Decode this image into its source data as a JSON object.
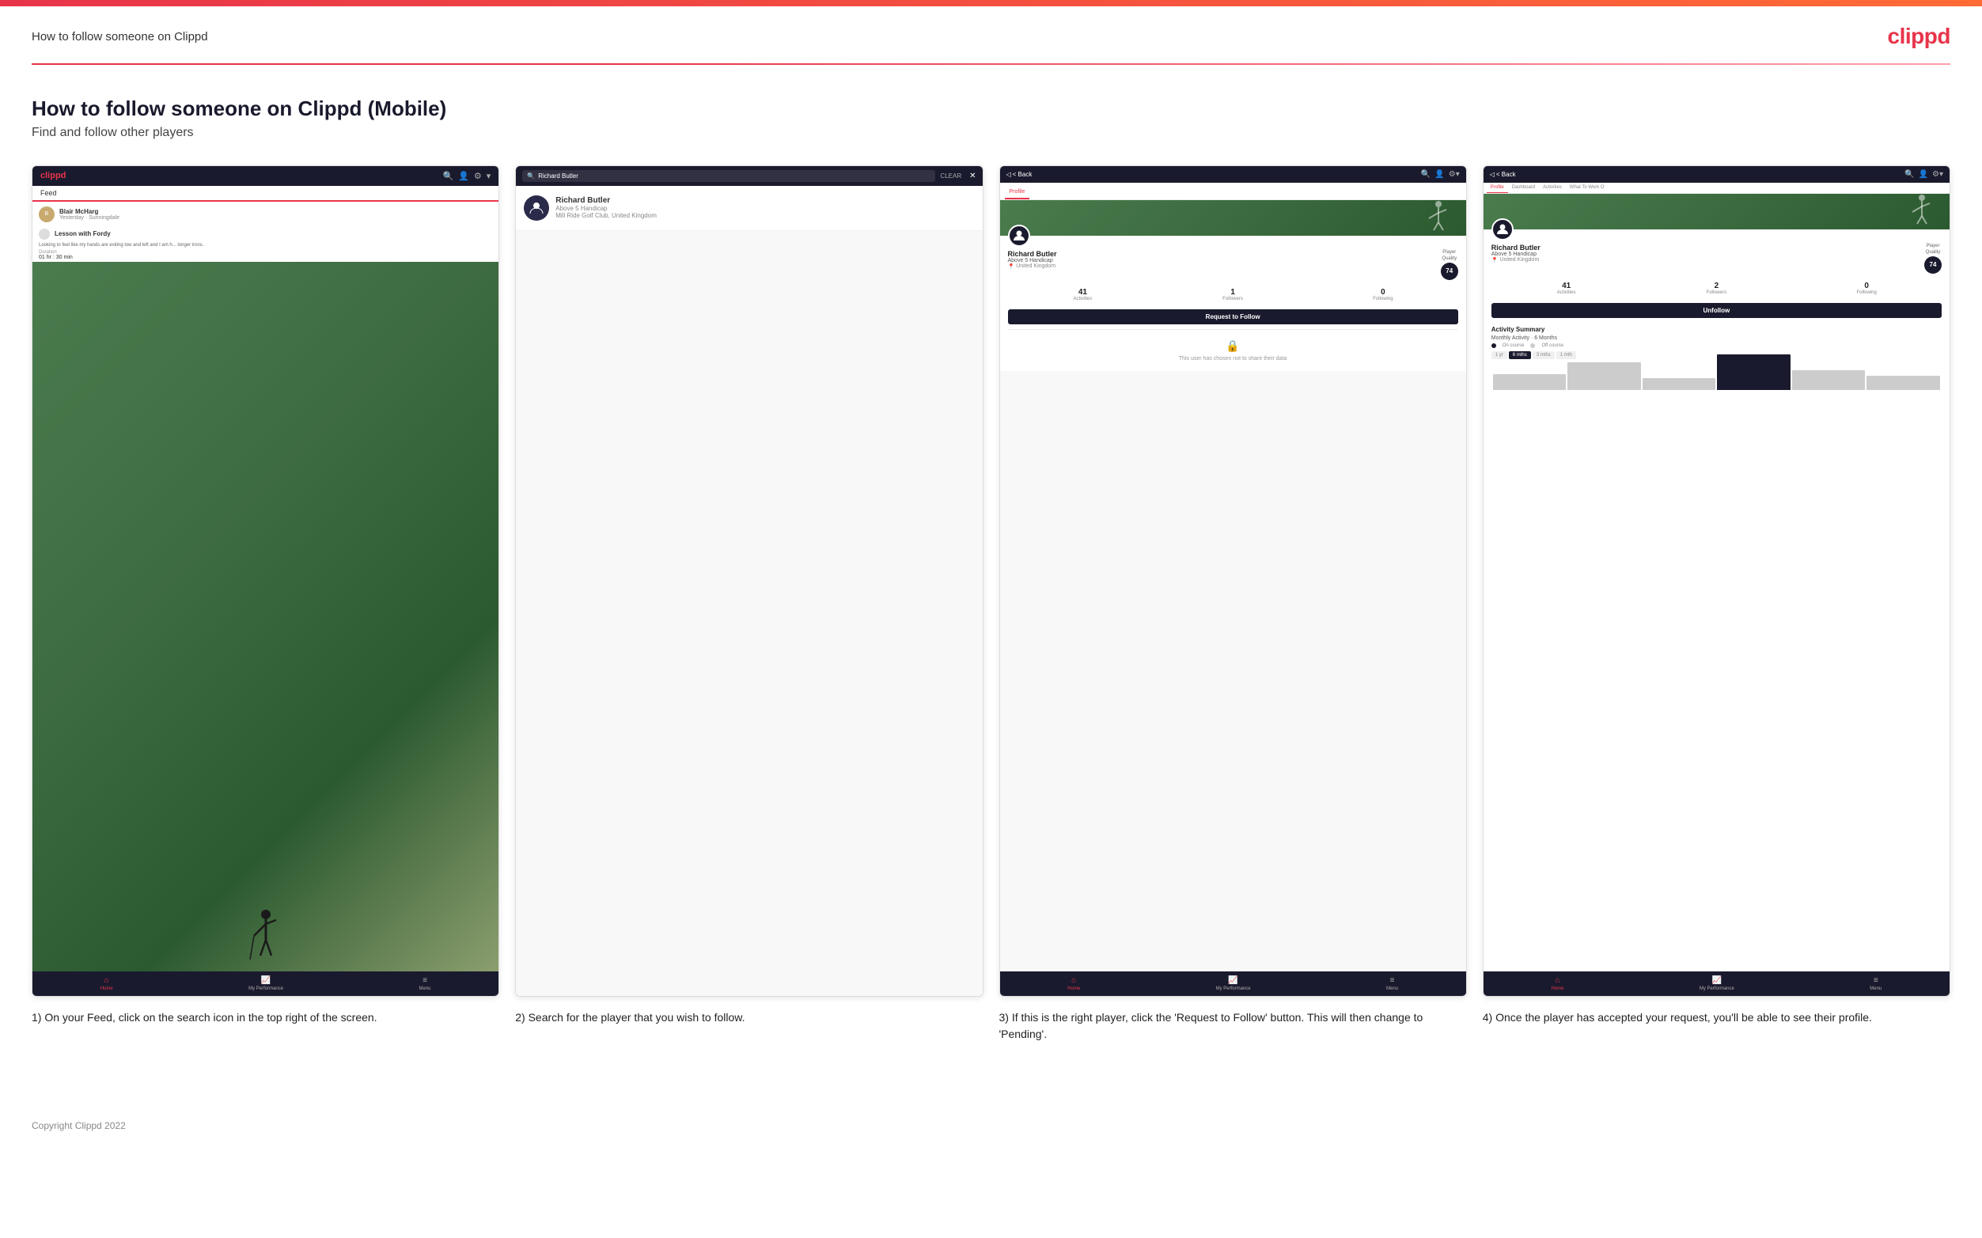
{
  "topbar": {},
  "header": {
    "title": "How to follow someone on Clippd",
    "logo": "clippd"
  },
  "page": {
    "heading": "How to follow someone on Clippd (Mobile)",
    "subheading": "Find and follow other players"
  },
  "steps": [
    {
      "id": "step1",
      "caption": "1) On your Feed, click on the search icon in the top right of the screen.",
      "screen": {
        "logo": "clippd",
        "tab": "Feed",
        "user_name": "Blair McHarg",
        "user_loc": "Yesterday · Sunningdale",
        "post_title": "Lesson with Fordy",
        "post_desc": "Looking to feel like my hands are exiting low and left and I am h... longer irons.",
        "duration_label": "Duration",
        "duration_val": "01 hr : 30 min",
        "nav_home": "Home",
        "nav_perf": "My Performance",
        "nav_menu": "Menu"
      }
    },
    {
      "id": "step2",
      "caption": "2) Search for the player that you wish to follow.",
      "screen": {
        "search_text": "Richard Butler",
        "clear_label": "CLEAR",
        "result_name": "Richard Butler",
        "result_handicap": "Above 5 Handicap",
        "result_club": "Mill Ride Golf Club, United Kingdom"
      }
    },
    {
      "id": "step3",
      "caption": "3) If this is the right player, click the 'Request to Follow' button. This will then change to 'Pending'.",
      "screen": {
        "back": "< Back",
        "tab_profile": "Profile",
        "player_name": "Richard Butler",
        "player_handicap": "Above 5 Handicap",
        "player_country": "United Kingdom",
        "quality_label": "Player Quality",
        "quality_val": "74",
        "activities": "41",
        "followers": "1",
        "following": "0",
        "activities_label": "Activities",
        "followers_label": "Followers",
        "following_label": "Following",
        "follow_btn": "Request to Follow",
        "private_text": "This user has chosen not to share their data",
        "nav_home": "Home",
        "nav_perf": "My Performance",
        "nav_menu": "Menu"
      }
    },
    {
      "id": "step4",
      "caption": "4) Once the player has accepted your request, you'll be able to see their profile.",
      "screen": {
        "back": "< Back",
        "tab_profile": "Profile",
        "tab_dashboard": "Dashboard",
        "tab_activities": "Activities",
        "tab_what": "What To Work O",
        "player_name": "Richard Butler",
        "player_handicap": "Above 5 Handicap",
        "player_country": "United Kingdom",
        "quality_label": "Player Quality",
        "quality_val": "74",
        "activities": "41",
        "followers": "2",
        "following": "0",
        "activities_label": "Activities",
        "followers_label": "Followers",
        "following_label": "Following",
        "follow_btn": "Unfollow",
        "activity_title": "Activity Summary",
        "activity_sub": "Monthly Activity · 6 Months",
        "legend_oncourse": "On course",
        "legend_offcourse": "Off course",
        "period_1yr": "1 yr",
        "period_6mths": "6 mths",
        "period_3mths": "3 mths",
        "period_1mth": "1 mth",
        "nav_home": "Home",
        "nav_perf": "My Performance",
        "nav_menu": "Menu"
      }
    }
  ],
  "footer": {
    "copyright": "Copyright Clippd 2022"
  },
  "chart": {
    "bars": [
      {
        "height": 20,
        "color": "#cccccc"
      },
      {
        "height": 35,
        "color": "#cccccc"
      },
      {
        "height": 15,
        "color": "#cccccc"
      },
      {
        "height": 45,
        "color": "#1a1a2e"
      },
      {
        "height": 25,
        "color": "#cccccc"
      },
      {
        "height": 18,
        "color": "#cccccc"
      }
    ]
  }
}
